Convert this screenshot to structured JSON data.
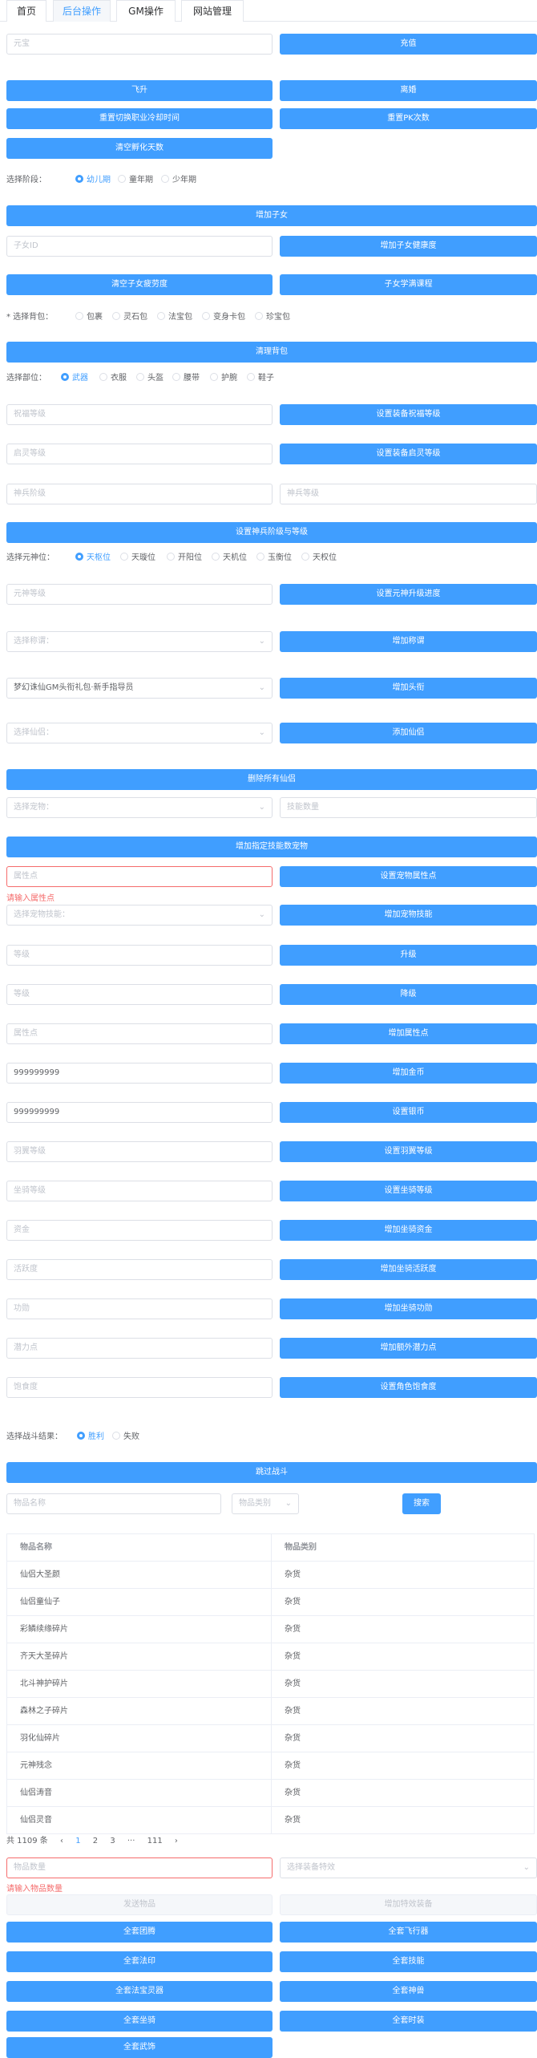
{
  "tabs": [
    {
      "label": "首页",
      "active": false
    },
    {
      "label": "后台操作",
      "active": true
    },
    {
      "label": "GM操作",
      "active": false
    },
    {
      "label": "网站管理",
      "active": false
    }
  ],
  "recharge": {
    "input_placeholder": "元宝",
    "button": "充值"
  },
  "buttons_a": {
    "ascend": "飞升",
    "leave": "离婚",
    "reset_job_cd": "重置切换职业冷却时间",
    "reset_pk": "重置PK次数",
    "clear_incubate": "清空孵化天数"
  },
  "stage": {
    "label": "选择阶段：",
    "options": [
      "幼儿期",
      "童年期",
      "少年期"
    ],
    "selected": 0
  },
  "child": {
    "add_button": "增加子女",
    "id_placeholder": "子女ID",
    "health_button": "增加子女健康度",
    "clear_fav_button": "清空子女疲劳度",
    "study_button": "子女学满课程"
  },
  "bag": {
    "label": "* 选择背包：",
    "options": [
      "包裹",
      "灵石包",
      "法宝包",
      "变身卡包",
      "珍宝包"
    ],
    "clear_button": "清理背包"
  },
  "part": {
    "label": "选择部位：",
    "options": [
      "武器",
      "衣服",
      "头盔",
      "腰带",
      "护腕",
      "鞋子"
    ],
    "selected": 0,
    "bless_placeholder": "祝福等级",
    "bless_button": "设置装备祝福等级",
    "soul_placeholder": "启灵等级",
    "soul_button": "设置装备启灵等级",
    "tier_placeholder": "神兵阶级",
    "level_placeholder": "神兵等级",
    "divine_button": "设置神兵阶级与等级"
  },
  "yuanshen": {
    "label": "选择元神位：",
    "options": [
      "天枢位",
      "天璇位",
      "开阳位",
      "天机位",
      "玉衡位",
      "天权位"
    ],
    "selected": 0,
    "level_placeholder": "元神等级",
    "level_button": "设置元神升级进度"
  },
  "title": {
    "placeholder": "选择称谓：",
    "button": "增加称谓"
  },
  "head": {
    "value": "梦幻诛仙GM头衔礼包·新手指导员",
    "button": "增加头衔"
  },
  "immortal": {
    "placeholder": "选择仙侣：",
    "button": "添加仙侣",
    "delete_all": "删除所有仙侣"
  },
  "pet": {
    "select_placeholder": "选择宠物：",
    "skill_count_placeholder": "技能数量",
    "add_specified_button": "增加指定技能数宠物",
    "attr_placeholder": "属性点",
    "attr_button": "设置宠物属性点",
    "attr_error": "请输入属性点",
    "skill_placeholder": "选择宠物技能：",
    "skill_button": "增加宠物技能"
  },
  "player": {
    "level_placeholder": "等级",
    "upgrade_button": "升级",
    "level2_placeholder": "等级",
    "downgrade_button": "降级",
    "attr_placeholder": "属性点",
    "attr_button": "增加属性点",
    "gold_value": "999999999",
    "gold_button": "增加金币",
    "coin_value": "999999999",
    "coin_button": "设置银币",
    "refine_placeholder": "羽翼等级",
    "refine_button": "设置羽翼等级",
    "mount_placeholder": "坐骑等级",
    "mount_button": "设置坐骑等级",
    "mount_exp_placeholder": "资金",
    "mount_exp_button": "增加坐骑资金",
    "mount_act_placeholder": "活跃度",
    "mount_act_button": "增加坐骑活跃度",
    "mount_merit_placeholder": "功勋",
    "mount_merit_button": "增加坐骑功勋",
    "potential_placeholder": "潜力点",
    "potential_button": "增加额外潜力点",
    "satiety_placeholder": "饱食度",
    "satiety_button": "设置角色饱食度"
  },
  "battle": {
    "label": "选择战斗结果：",
    "options": [
      "胜利",
      "失败"
    ],
    "selected": 0,
    "button": "跳过战斗"
  },
  "search": {
    "name_placeholder": "物品名称",
    "type_placeholder": "物品类别",
    "button": "搜索"
  },
  "item_table": {
    "headers": [
      "物品名称",
      "物品类别"
    ],
    "rows": [
      [
        "仙侣大圣颜",
        "杂货"
      ],
      [
        "仙侣童仙子",
        "杂货"
      ],
      [
        "彩鳞续缘碎片",
        "杂货"
      ],
      [
        "齐天大圣碎片",
        "杂货"
      ],
      [
        "北斗神护碎片",
        "杂货"
      ],
      [
        "森林之子碎片",
        "杂货"
      ],
      [
        "羽化仙碎片",
        "杂货"
      ],
      [
        "元神残念",
        "杂货"
      ],
      [
        "仙侣涛音",
        "杂货"
      ],
      [
        "仙侣灵音",
        "杂货"
      ]
    ]
  },
  "pagination": {
    "total": "共 1109 条",
    "prev": "‹",
    "pages": [
      "1",
      "2",
      "3",
      "···",
      "111"
    ],
    "next": "›"
  },
  "send": {
    "qty_placeholder": "物品数量",
    "qty_error": "请输入物品数量",
    "attr_placeholder": "选择装备特效",
    "send_button": "发送物品",
    "add_special_button": "增加特效装备"
  },
  "all_buttons": {
    "all_immortal": "全套团腾",
    "all_fly": "全套飞行器",
    "all_law": "全套法印",
    "all_skill": "全套技能",
    "all_treasure": "全套法宝灵器",
    "all_divine": "全套神兽",
    "all_mount": "全套坐骑",
    "all_fashion": "全套时装",
    "all_ascend": "全套武饰"
  }
}
